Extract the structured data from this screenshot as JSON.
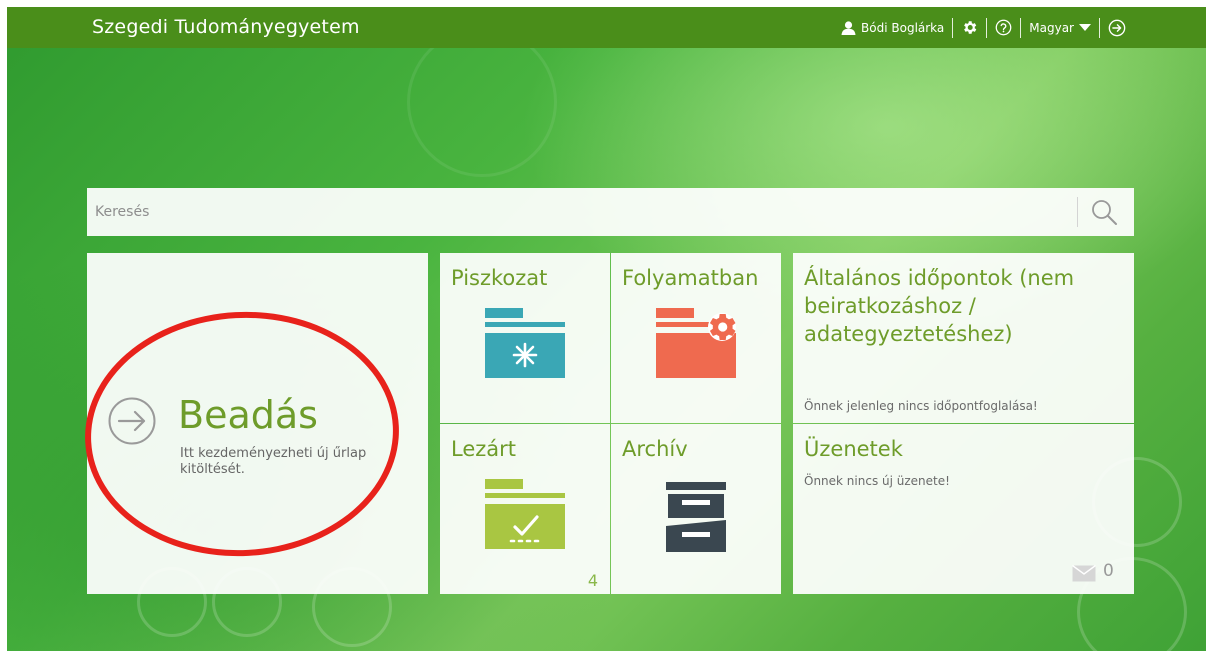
{
  "header": {
    "brand": "Szegedi Tudományegyetem",
    "user_name": "Bódi Boglárka",
    "language": "Magyar"
  },
  "search": {
    "placeholder": "Keresés"
  },
  "tiles": {
    "beadas": {
      "title": "Beadás",
      "description": "Itt kezdeményezheti új űrlap kitöltését."
    },
    "piszkozat": {
      "title": "Piszkozat"
    },
    "folyamatban": {
      "title": "Folyamatban"
    },
    "lezart": {
      "title": "Lezárt",
      "count": "4"
    },
    "archiv": {
      "title": "Archív"
    },
    "dates": {
      "title": "Általános időpontok (nem beiratkozáshoz / adategyeztetéshez)",
      "note": "Önnek jelenleg nincs időpontfoglalása!"
    },
    "messages": {
      "title": "Üzenetek",
      "note": "Önnek nincs új üzenete!",
      "count": "0"
    }
  },
  "colors": {
    "header_bg": "#4a8e1a",
    "tile_title": "#6e9c2a",
    "draft_icon": "#3aa7b5",
    "progress_icon": "#ef6a4f",
    "closed_icon": "#a9c642",
    "archive_icon": "#3a4750",
    "highlight_ring": "#e8221b"
  }
}
